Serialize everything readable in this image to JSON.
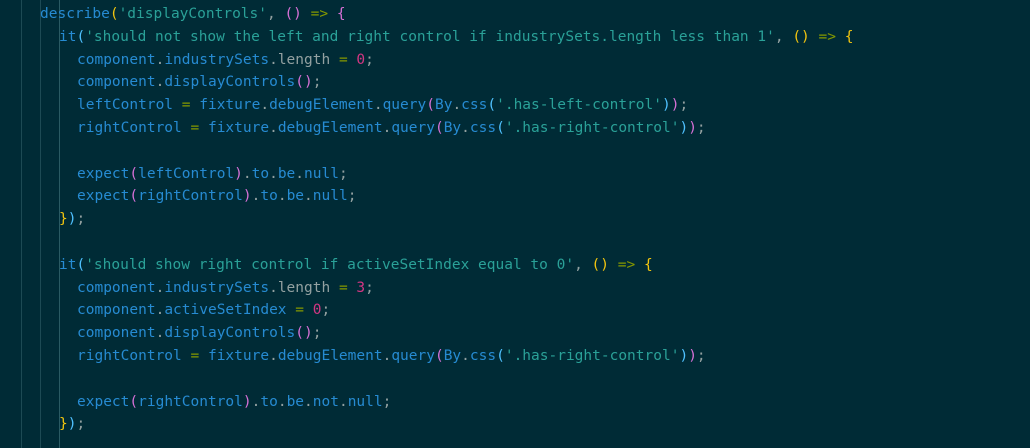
{
  "editor": {
    "lines": [
      {
        "indent": 0,
        "tokens": [
          {
            "t": "describe",
            "k": "tk"
          },
          {
            "t": "(",
            "k": "br1"
          },
          {
            "t": "'displayControls'",
            "k": "st"
          },
          {
            "t": ", ",
            "k": "pn"
          },
          {
            "t": "()",
            "k": "br2"
          },
          {
            "t": " ",
            "k": "pn"
          },
          {
            "t": "=>",
            "k": "op"
          },
          {
            "t": " ",
            "k": "pn"
          },
          {
            "t": "{",
            "k": "br2"
          }
        ]
      },
      {
        "indent": 1,
        "tokens": [
          {
            "t": "it",
            "k": "tk"
          },
          {
            "t": "(",
            "k": "br3"
          },
          {
            "t": "'should not show the left and right control if industrySets.length less than 1'",
            "k": "st"
          },
          {
            "t": ", ",
            "k": "pn"
          },
          {
            "t": "()",
            "k": "br1"
          },
          {
            "t": " ",
            "k": "pn"
          },
          {
            "t": "=>",
            "k": "op"
          },
          {
            "t": " ",
            "k": "pn"
          },
          {
            "t": "{",
            "k": "br1"
          }
        ]
      },
      {
        "indent": 2,
        "tokens": [
          {
            "t": "component",
            "k": "tk"
          },
          {
            "t": ".",
            "k": "pn"
          },
          {
            "t": "industrySets",
            "k": "tk"
          },
          {
            "t": ".",
            "k": "pn"
          },
          {
            "t": "length",
            "k": "pn"
          },
          {
            "t": " ",
            "k": "pn"
          },
          {
            "t": "=",
            "k": "op"
          },
          {
            "t": " ",
            "k": "pn"
          },
          {
            "t": "0",
            "k": "nm"
          },
          {
            "t": ";",
            "k": "pn"
          }
        ]
      },
      {
        "indent": 2,
        "tokens": [
          {
            "t": "component",
            "k": "tk"
          },
          {
            "t": ".",
            "k": "pn"
          },
          {
            "t": "displayControls",
            "k": "tk"
          },
          {
            "t": "()",
            "k": "br2"
          },
          {
            "t": ";",
            "k": "pn"
          }
        ]
      },
      {
        "indent": 2,
        "tokens": [
          {
            "t": "leftControl",
            "k": "tk"
          },
          {
            "t": " ",
            "k": "pn"
          },
          {
            "t": "=",
            "k": "op"
          },
          {
            "t": " ",
            "k": "pn"
          },
          {
            "t": "fixture",
            "k": "tk"
          },
          {
            "t": ".",
            "k": "pn"
          },
          {
            "t": "debugElement",
            "k": "tk"
          },
          {
            "t": ".",
            "k": "pn"
          },
          {
            "t": "query",
            "k": "tk"
          },
          {
            "t": "(",
            "k": "br2"
          },
          {
            "t": "By",
            "k": "tk"
          },
          {
            "t": ".",
            "k": "pn"
          },
          {
            "t": "css",
            "k": "tk"
          },
          {
            "t": "(",
            "k": "br3"
          },
          {
            "t": "'.has-left-control'",
            "k": "st"
          },
          {
            "t": ")",
            "k": "br3"
          },
          {
            "t": ")",
            "k": "br2"
          },
          {
            "t": ";",
            "k": "pn"
          }
        ]
      },
      {
        "indent": 2,
        "tokens": [
          {
            "t": "rightControl",
            "k": "tk"
          },
          {
            "t": " ",
            "k": "pn"
          },
          {
            "t": "=",
            "k": "op"
          },
          {
            "t": " ",
            "k": "pn"
          },
          {
            "t": "fixture",
            "k": "tk"
          },
          {
            "t": ".",
            "k": "pn"
          },
          {
            "t": "debugElement",
            "k": "tk"
          },
          {
            "t": ".",
            "k": "pn"
          },
          {
            "t": "query",
            "k": "tk"
          },
          {
            "t": "(",
            "k": "br2"
          },
          {
            "t": "By",
            "k": "tk"
          },
          {
            "t": ".",
            "k": "pn"
          },
          {
            "t": "css",
            "k": "tk"
          },
          {
            "t": "(",
            "k": "br3"
          },
          {
            "t": "'.has-right-control'",
            "k": "st"
          },
          {
            "t": ")",
            "k": "br3"
          },
          {
            "t": ")",
            "k": "br2"
          },
          {
            "t": ";",
            "k": "pn"
          }
        ]
      },
      {
        "indent": 2,
        "tokens": []
      },
      {
        "indent": 2,
        "tokens": [
          {
            "t": "expect",
            "k": "tk"
          },
          {
            "t": "(",
            "k": "br2"
          },
          {
            "t": "leftControl",
            "k": "tk"
          },
          {
            "t": ")",
            "k": "br2"
          },
          {
            "t": ".",
            "k": "pn"
          },
          {
            "t": "to",
            "k": "tk"
          },
          {
            "t": ".",
            "k": "pn"
          },
          {
            "t": "be",
            "k": "tk"
          },
          {
            "t": ".",
            "k": "pn"
          },
          {
            "t": "null",
            "k": "tk"
          },
          {
            "t": ";",
            "k": "pn"
          }
        ]
      },
      {
        "indent": 2,
        "tokens": [
          {
            "t": "expect",
            "k": "tk"
          },
          {
            "t": "(",
            "k": "br2"
          },
          {
            "t": "rightControl",
            "k": "tk"
          },
          {
            "t": ")",
            "k": "br2"
          },
          {
            "t": ".",
            "k": "pn"
          },
          {
            "t": "to",
            "k": "tk"
          },
          {
            "t": ".",
            "k": "pn"
          },
          {
            "t": "be",
            "k": "tk"
          },
          {
            "t": ".",
            "k": "pn"
          },
          {
            "t": "null",
            "k": "tk"
          },
          {
            "t": ";",
            "k": "pn"
          }
        ]
      },
      {
        "indent": 1,
        "tokens": [
          {
            "t": "}",
            "k": "br1"
          },
          {
            "t": ")",
            "k": "br3"
          },
          {
            "t": ";",
            "k": "pn"
          }
        ]
      },
      {
        "indent": 1,
        "tokens": []
      },
      {
        "indent": 1,
        "tokens": [
          {
            "t": "it",
            "k": "tk"
          },
          {
            "t": "(",
            "k": "br3"
          },
          {
            "t": "'should show right control if activeSetIndex equal to 0'",
            "k": "st"
          },
          {
            "t": ", ",
            "k": "pn"
          },
          {
            "t": "()",
            "k": "br1"
          },
          {
            "t": " ",
            "k": "pn"
          },
          {
            "t": "=>",
            "k": "op"
          },
          {
            "t": " ",
            "k": "pn"
          },
          {
            "t": "{",
            "k": "br1"
          }
        ]
      },
      {
        "indent": 2,
        "tokens": [
          {
            "t": "component",
            "k": "tk"
          },
          {
            "t": ".",
            "k": "pn"
          },
          {
            "t": "industrySets",
            "k": "tk"
          },
          {
            "t": ".",
            "k": "pn"
          },
          {
            "t": "length",
            "k": "pn"
          },
          {
            "t": " ",
            "k": "pn"
          },
          {
            "t": "=",
            "k": "op"
          },
          {
            "t": " ",
            "k": "pn"
          },
          {
            "t": "3",
            "k": "nm"
          },
          {
            "t": ";",
            "k": "pn"
          }
        ]
      },
      {
        "indent": 2,
        "tokens": [
          {
            "t": "component",
            "k": "tk"
          },
          {
            "t": ".",
            "k": "pn"
          },
          {
            "t": "activeSetIndex",
            "k": "tk"
          },
          {
            "t": " ",
            "k": "pn"
          },
          {
            "t": "=",
            "k": "op"
          },
          {
            "t": " ",
            "k": "pn"
          },
          {
            "t": "0",
            "k": "nm"
          },
          {
            "t": ";",
            "k": "pn"
          }
        ]
      },
      {
        "indent": 2,
        "tokens": [
          {
            "t": "component",
            "k": "tk"
          },
          {
            "t": ".",
            "k": "pn"
          },
          {
            "t": "displayControls",
            "k": "tk"
          },
          {
            "t": "()",
            "k": "br2"
          },
          {
            "t": ";",
            "k": "pn"
          }
        ]
      },
      {
        "indent": 2,
        "tokens": [
          {
            "t": "rightControl",
            "k": "tk"
          },
          {
            "t": " ",
            "k": "pn"
          },
          {
            "t": "=",
            "k": "op"
          },
          {
            "t": " ",
            "k": "pn"
          },
          {
            "t": "fixture",
            "k": "tk"
          },
          {
            "t": ".",
            "k": "pn"
          },
          {
            "t": "debugElement",
            "k": "tk"
          },
          {
            "t": ".",
            "k": "pn"
          },
          {
            "t": "query",
            "k": "tk"
          },
          {
            "t": "(",
            "k": "br2"
          },
          {
            "t": "By",
            "k": "tk"
          },
          {
            "t": ".",
            "k": "pn"
          },
          {
            "t": "css",
            "k": "tk"
          },
          {
            "t": "(",
            "k": "br3"
          },
          {
            "t": "'.has-right-control'",
            "k": "st"
          },
          {
            "t": ")",
            "k": "br3"
          },
          {
            "t": ")",
            "k": "br2"
          },
          {
            "t": ";",
            "k": "pn"
          }
        ]
      },
      {
        "indent": 2,
        "tokens": []
      },
      {
        "indent": 2,
        "tokens": [
          {
            "t": "expect",
            "k": "tk"
          },
          {
            "t": "(",
            "k": "br2"
          },
          {
            "t": "rightControl",
            "k": "tk"
          },
          {
            "t": ")",
            "k": "br2"
          },
          {
            "t": ".",
            "k": "pn"
          },
          {
            "t": "to",
            "k": "tk"
          },
          {
            "t": ".",
            "k": "pn"
          },
          {
            "t": "be",
            "k": "tk"
          },
          {
            "t": ".",
            "k": "pn"
          },
          {
            "t": "not",
            "k": "tk"
          },
          {
            "t": ".",
            "k": "pn"
          },
          {
            "t": "null",
            "k": "tk"
          },
          {
            "t": ";",
            "k": "pn"
          }
        ]
      },
      {
        "indent": 1,
        "tokens": [
          {
            "t": "}",
            "k": "br1"
          },
          {
            "t": ")",
            "k": "br3"
          },
          {
            "t": ";",
            "k": "pn"
          }
        ]
      }
    ]
  }
}
